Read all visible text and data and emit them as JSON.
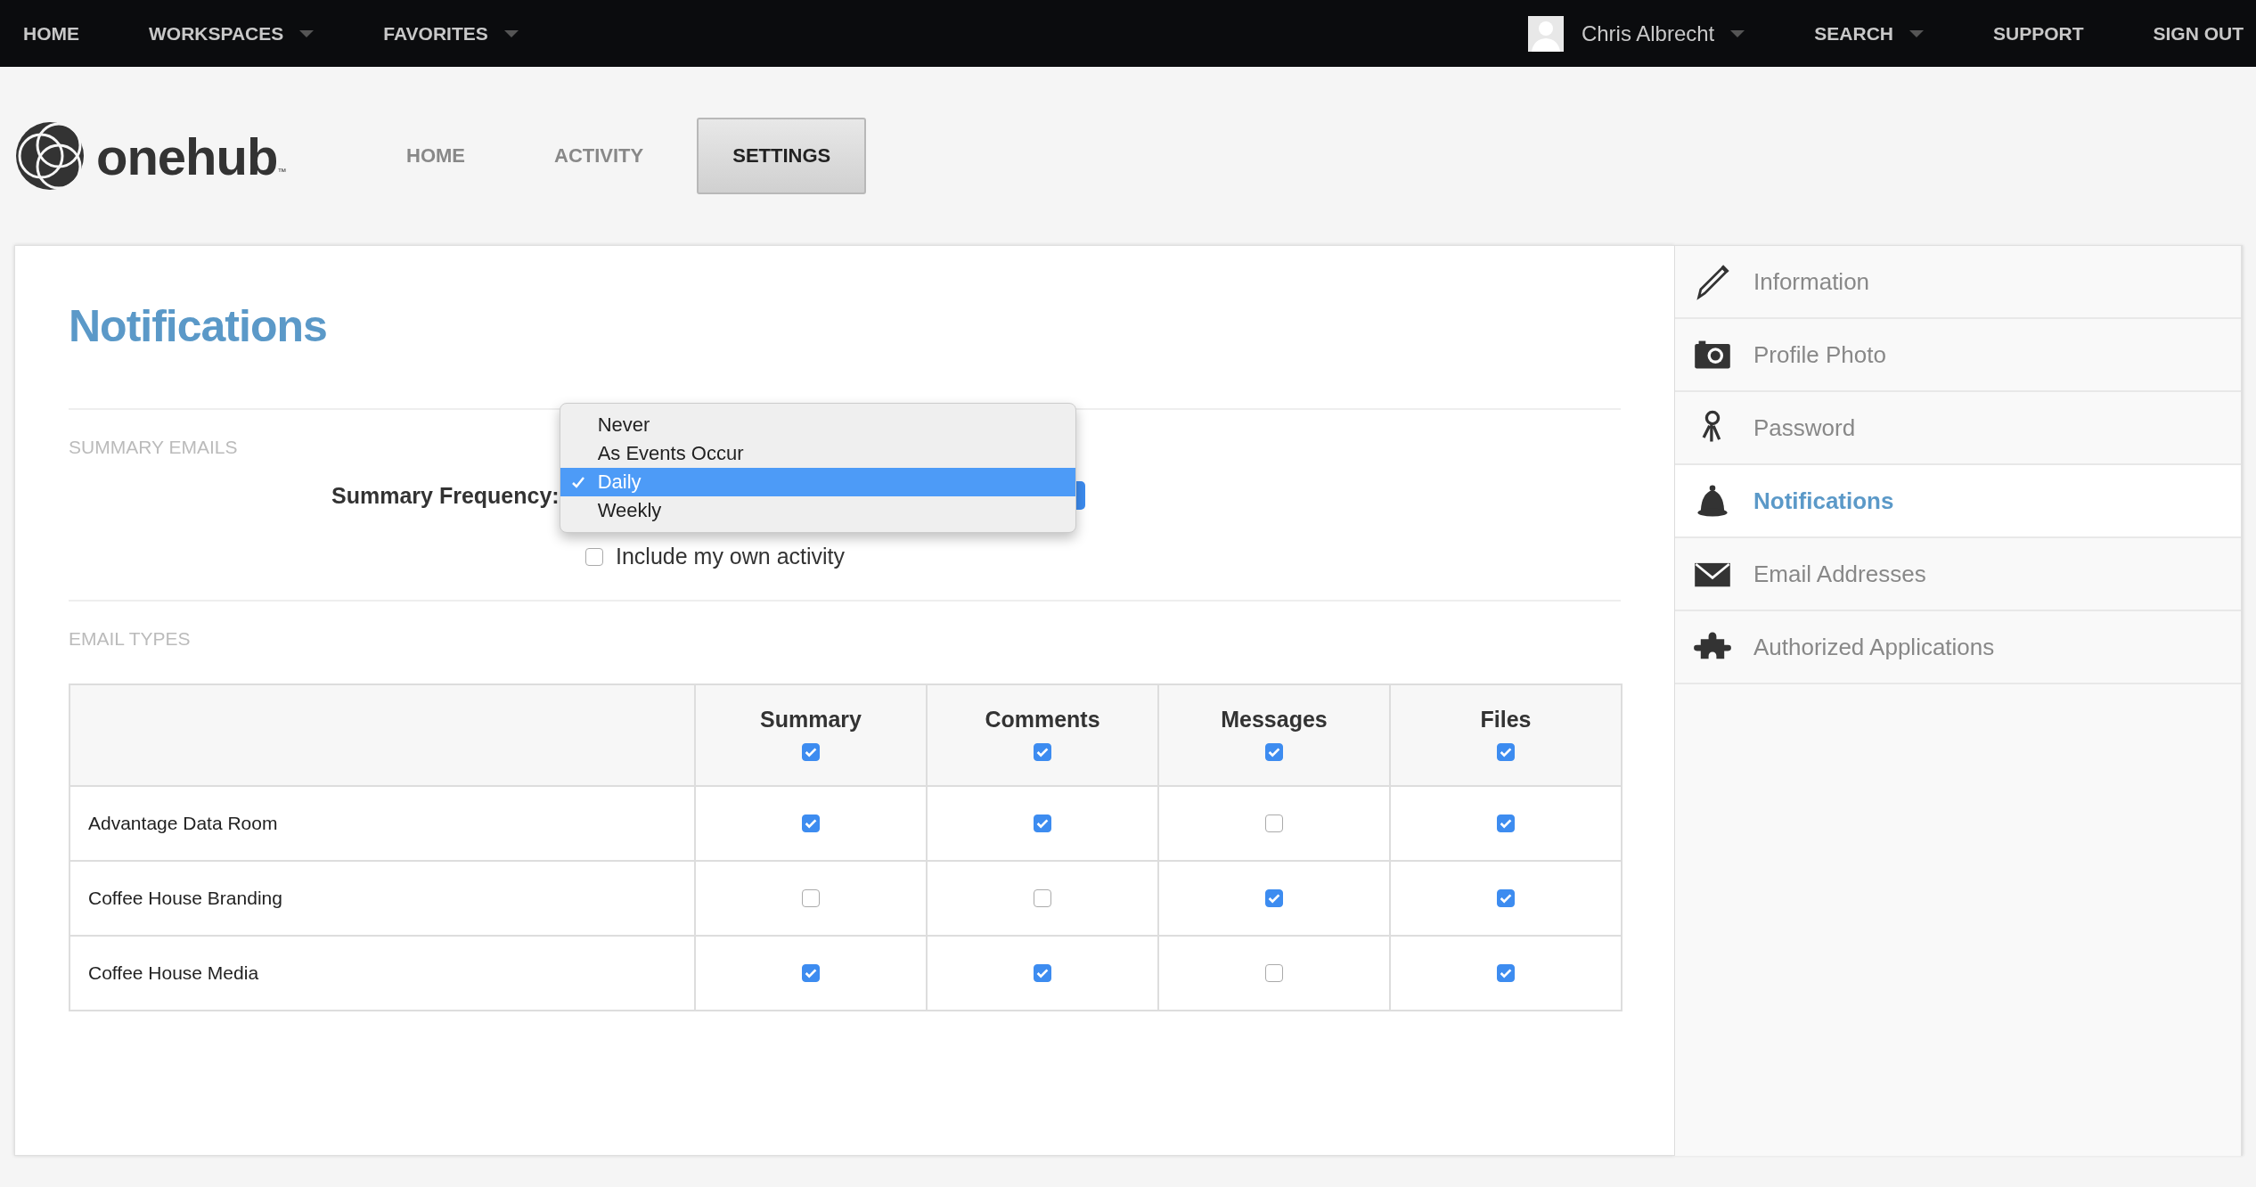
{
  "top_nav": {
    "left": [
      {
        "label": "HOME",
        "has_menu": false
      },
      {
        "label": "WORKSPACES",
        "has_menu": true
      },
      {
        "label": "FAVORITES",
        "has_menu": true
      }
    ],
    "user": {
      "name": "Chris Albrecht",
      "has_menu": true
    },
    "right": [
      {
        "label": "SEARCH",
        "has_menu": true
      },
      {
        "label": "SUPPORT",
        "has_menu": false
      },
      {
        "label": "SIGN OUT",
        "has_menu": false
      }
    ]
  },
  "logo": {
    "name": "onehub",
    "trademark": "™"
  },
  "tabs": [
    {
      "label": "HOME",
      "selected": false
    },
    {
      "label": "ACTIVITY",
      "selected": false
    },
    {
      "label": "SETTINGS",
      "selected": true
    }
  ],
  "title": "Notifications",
  "summary_emails": {
    "heading": "SUMMARY EMAILS",
    "frequency_label": "Summary Frequency:",
    "options": [
      {
        "label": "Never",
        "selected": false
      },
      {
        "label": "As Events Occur",
        "selected": false
      },
      {
        "label": "Daily",
        "selected": true
      },
      {
        "label": "Weekly",
        "selected": false
      }
    ],
    "include_own_activity": {
      "label": "Include my own activity",
      "checked": false
    }
  },
  "email_types": {
    "heading": "EMAIL TYPES",
    "columns": [
      {
        "label": "Summary",
        "checked": true
      },
      {
        "label": "Comments",
        "checked": true
      },
      {
        "label": "Messages",
        "checked": true
      },
      {
        "label": "Files",
        "checked": true
      }
    ],
    "rows": [
      {
        "name": "Advantage Data Room",
        "checks": [
          true,
          true,
          false,
          true
        ]
      },
      {
        "name": "Coffee House Branding",
        "checks": [
          false,
          false,
          true,
          true
        ]
      },
      {
        "name": "Coffee House Media",
        "checks": [
          true,
          true,
          false,
          true
        ]
      }
    ]
  },
  "sidebar": [
    {
      "label": "Information",
      "selected": false
    },
    {
      "label": "Profile Photo",
      "selected": false
    },
    {
      "label": "Password",
      "selected": false
    },
    {
      "label": "Notifications",
      "selected": true
    },
    {
      "label": "Email Addresses",
      "selected": false
    },
    {
      "label": "Authorized Applications",
      "selected": false
    }
  ]
}
